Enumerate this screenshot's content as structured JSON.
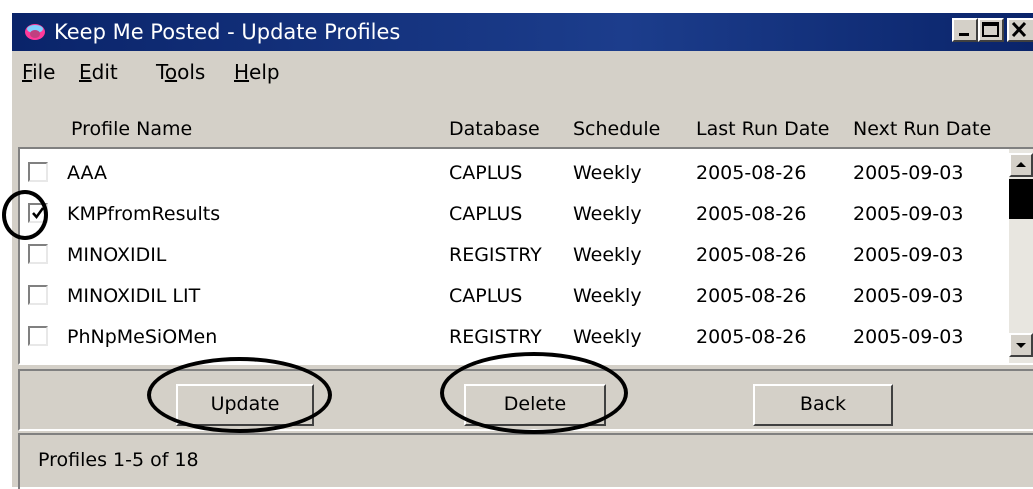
{
  "window": {
    "title": "Keep Me Posted - Update Profiles"
  },
  "menu": [
    {
      "underline": "F",
      "rest": "ile"
    },
    {
      "underline": "E",
      "rest": "dit"
    },
    {
      "pre": "T",
      "underline": "o",
      "rest": "ols"
    },
    {
      "underline": "H",
      "rest": "elp"
    }
  ],
  "columns": {
    "profile_name": "Profile Name",
    "database": "Database",
    "schedule": "Schedule",
    "last_run": "Last Run Date",
    "next_run": "Next Run Date"
  },
  "rows": [
    {
      "checked": false,
      "name": "AAA",
      "database": "CAPLUS",
      "schedule": "Weekly",
      "last_run": "2005-08-26",
      "next_run": "2005-09-03"
    },
    {
      "checked": true,
      "name": "KMPfromResults",
      "database": "CAPLUS",
      "schedule": "Weekly",
      "last_run": "2005-08-26",
      "next_run": "2005-09-03"
    },
    {
      "checked": false,
      "name": "MINOXIDIL",
      "database": "REGISTRY",
      "schedule": "Weekly",
      "last_run": "2005-08-26",
      "next_run": "2005-09-03"
    },
    {
      "checked": false,
      "name": "MINOXIDIL LIT",
      "database": "CAPLUS",
      "schedule": "Weekly",
      "last_run": "2005-08-26",
      "next_run": "2005-09-03"
    },
    {
      "checked": false,
      "name": "PhNpMeSiOMen",
      "database": "REGISTRY",
      "schedule": "Weekly",
      "last_run": "2005-08-26",
      "next_run": "2005-09-03"
    }
  ],
  "buttons": {
    "update": "Update",
    "delete": "Delete",
    "back": "Back"
  },
  "status": "Profiles 1-5 of 18",
  "icons": {
    "app": "kmp-app-icon",
    "minimize": "minimize-icon",
    "maximize": "maximize-icon",
    "close": "close-icon"
  },
  "colors": {
    "titlebar": "#0a246a",
    "window_bg": "#d4d0c8",
    "annotation": "#000000"
  }
}
